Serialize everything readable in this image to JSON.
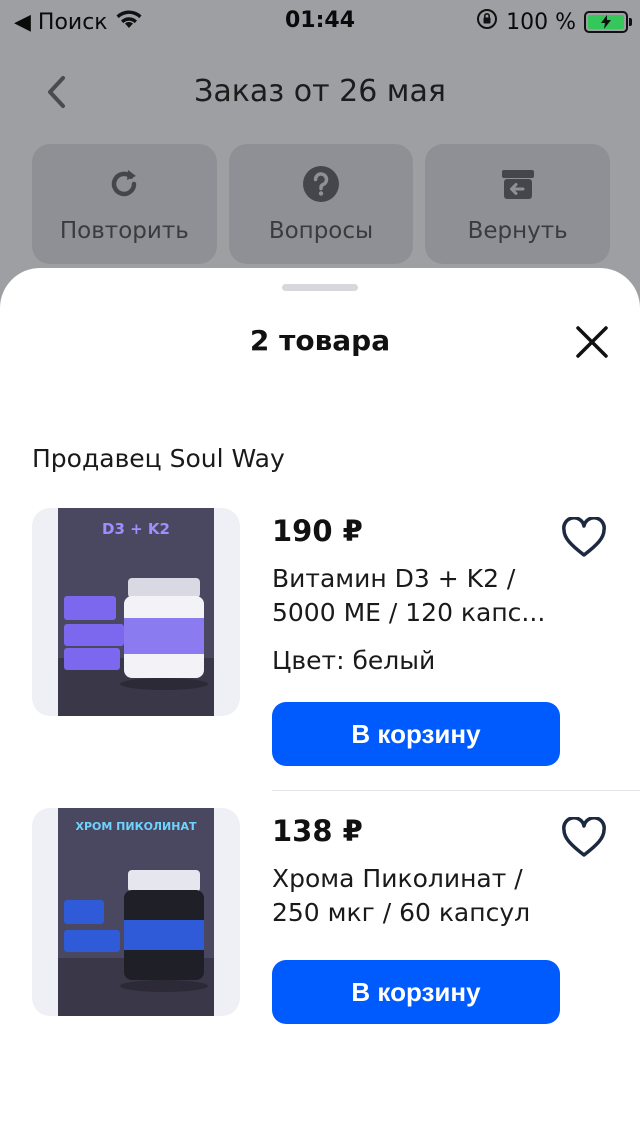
{
  "status_bar": {
    "back_app": "◀ Поиск",
    "time": "01:44",
    "battery_percent": "100 %"
  },
  "header": {
    "title": "Заказ от 26 мая"
  },
  "actions": [
    {
      "label": "Повторить",
      "icon": "repeat-icon"
    },
    {
      "label": "Вопросы",
      "icon": "question-icon"
    },
    {
      "label": "Вернуть",
      "icon": "return-box-icon"
    }
  ],
  "sheet": {
    "title": "2 товара",
    "seller": "Продавец Soul Way"
  },
  "products": [
    {
      "price": "190 ₽",
      "name": "Витамин D3 + K2 / 5000 МЕ / 120 капс...",
      "color": "Цвет: белый",
      "cart_label": "В корзину",
      "image_text": "D3 + K2"
    },
    {
      "price": "138 ₽",
      "name": "Хрома Пиколинат / 250 мкг / 60 капсул",
      "cart_label": "В корзину",
      "image_text": "ХРОМ ПИКОЛИНАТ"
    }
  ],
  "colors": {
    "accent": "#005bff",
    "sheet_bg": "#ffffff",
    "dim_bg": "#9e9fa3"
  }
}
